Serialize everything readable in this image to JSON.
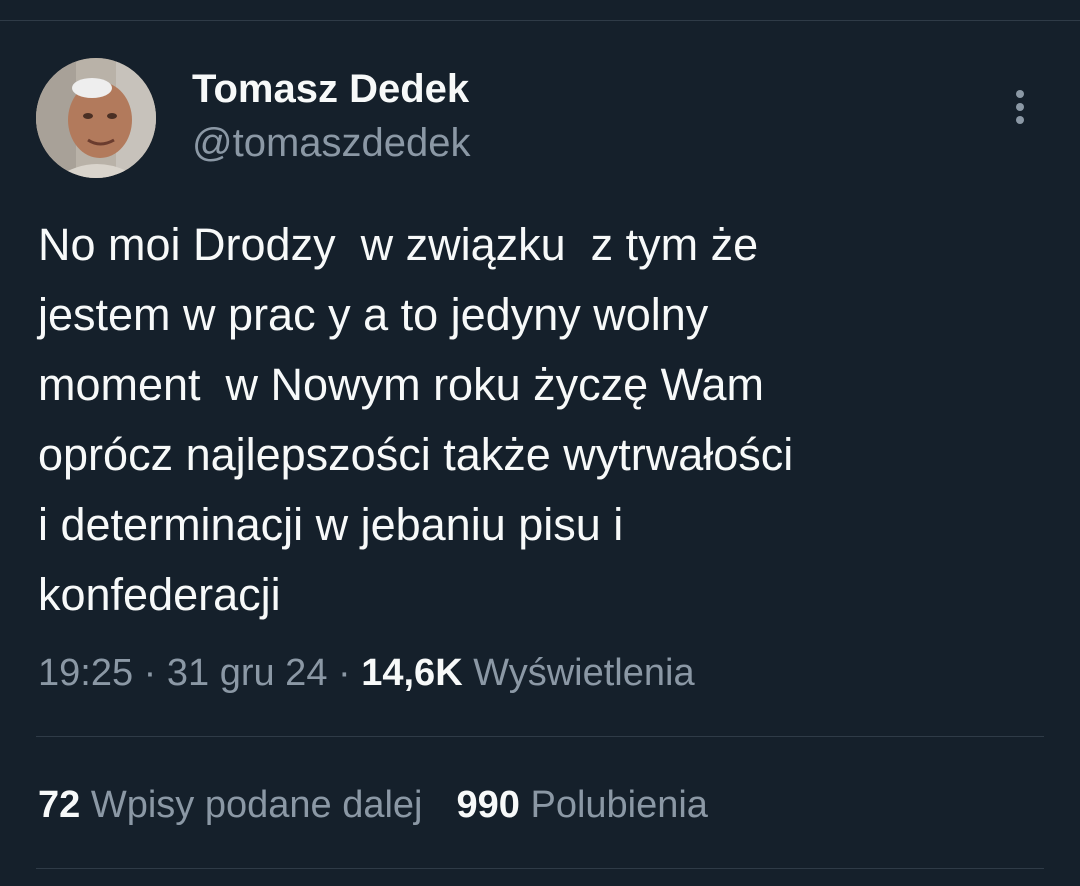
{
  "tweet": {
    "author": {
      "display_name": "Tomasz Dedek",
      "handle": "@tomaszdedek"
    },
    "text_lines": [
      "No moi Drodzy  w związku  z tym że",
      "jestem w prac y a to jedyny wolny",
      "moment  w Nowym roku życzę Wam",
      "oprócz najlepszości także wytrwałości",
      "i determinacji w jebaniu pisu i",
      "konfederacji"
    ],
    "meta": {
      "time": "19:25",
      "separator": " · ",
      "date": "31 gru 24",
      "views_count": "14,6K",
      "views_label": "Wyświetlenia"
    },
    "stats": {
      "reposts_count": "72",
      "reposts_label": "Wpisy podane dalej",
      "likes_count": "990",
      "likes_label": "Polubienia"
    }
  },
  "colors": {
    "background": "#15202b",
    "primary_text": "#f7f9f9",
    "secondary_text": "#8b98a5",
    "divider": "#2f3b47"
  },
  "icons": {
    "more": "more-vertical-icon"
  }
}
